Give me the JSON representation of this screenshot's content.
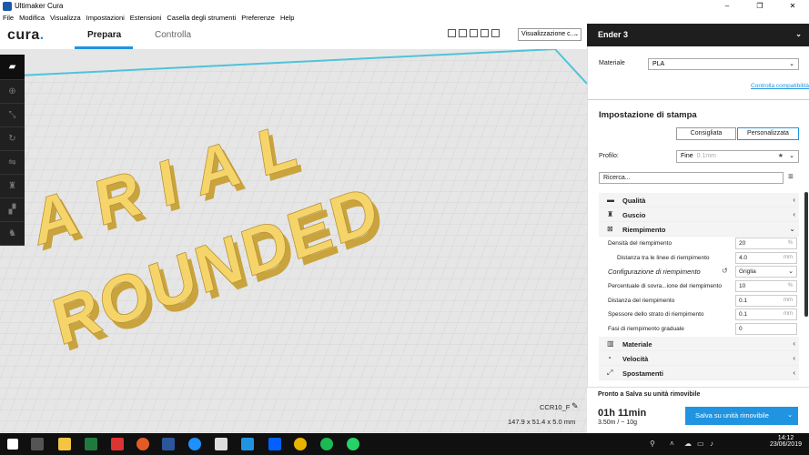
{
  "window": {
    "title": "Ultimaker Cura",
    "controls": [
      "–",
      "❐",
      "✕"
    ]
  },
  "menu": [
    "File",
    "Modifica",
    "Visualizza",
    "Impostazioni",
    "Estensioni",
    "Casella degli strumenti",
    "Preferenze",
    "Help"
  ],
  "header": {
    "logo_text": "cura",
    "logo_dot": ".",
    "tabs": [
      "Prepara",
      "Controlla"
    ],
    "active_tab": "Prepara",
    "view_select": "Visualizzazione c..."
  },
  "viewport": {
    "words": [
      "ARIAL",
      "ROUNDED"
    ],
    "model_color": "#f5d56a",
    "object_name": "CCR10_F",
    "object_dims": "147.9 x 51.4 x 5.0 mm"
  },
  "printer": {
    "name": "Ender 3"
  },
  "material": {
    "label": "Materiale",
    "value": "PLA",
    "compat_link": "Controlla compatibilità"
  },
  "print_setup": {
    "title": "Impostazione di stampa",
    "modes": [
      "Consigliata",
      "Personalizzata"
    ],
    "active_mode": "Personalizzata",
    "profile_label": "Profilo:",
    "profile_value": "Fine",
    "profile_sub": "0.1mm",
    "search_placeholder": "Ricerca..."
  },
  "categories_top": [
    {
      "name": "quality",
      "icon": "▬",
      "label": "Qualità",
      "chev": "‹"
    },
    {
      "name": "shell",
      "icon": "♜",
      "label": "Guscio",
      "chev": "‹"
    },
    {
      "name": "infill",
      "icon": "⊠",
      "label": "Riempimento",
      "chev": "⌄"
    }
  ],
  "infill_settings": [
    {
      "label": "Densità del riempimento",
      "value": "20",
      "unit": "%"
    },
    {
      "label": "Distanza tra le linee di riempimento",
      "value": "4.0",
      "unit": "mm",
      "indent": true
    },
    {
      "label": "Configurazione di riempimento",
      "value": "Griglia",
      "select": true,
      "italic": true,
      "reset": "↺"
    },
    {
      "label": "Percentuale di sovra...ione del riempimento",
      "value": "10",
      "unit": "%"
    },
    {
      "label": "Distanza del riempimento",
      "value": "0.1",
      "unit": "mm"
    },
    {
      "label": "Spessore dello strato di riempimento",
      "value": "0.1",
      "unit": "mm"
    },
    {
      "label": "Fasi di riempimento graduale",
      "value": "0",
      "unit": ""
    }
  ],
  "categories_bottom": [
    {
      "name": "material",
      "icon": "▥",
      "label": "Materiale",
      "chev": "‹"
    },
    {
      "name": "speed",
      "icon": "◔",
      "label": "Velocità",
      "chev": "‹"
    },
    {
      "name": "travel",
      "icon": "⤢",
      "label": "Spostamenti",
      "chev": "‹"
    }
  ],
  "action": {
    "status": "Pronto a Salva su unità rimovibile",
    "time": "01h 11min",
    "usage": "3.50m / ~ 10g",
    "save_label": "Salva su unità rimovibile"
  },
  "taskbar": {
    "time": "14:12",
    "date": "23/06/2019"
  },
  "colors": {
    "accent": "#2094e0",
    "dark": "#1e1e1e",
    "model": "#f5d56a"
  }
}
